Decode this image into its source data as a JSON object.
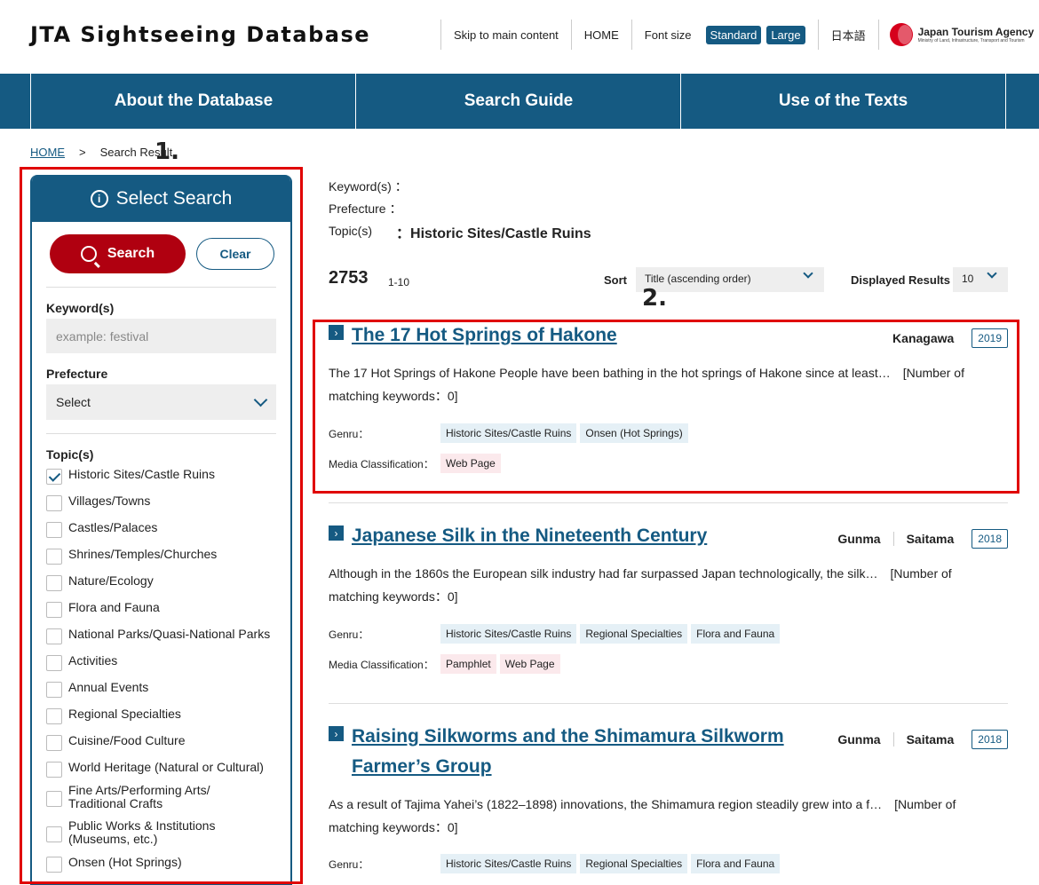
{
  "header": {
    "site_title": "JTA Sightseeing Database",
    "skip_link": "Skip to main content",
    "home": "HOME",
    "font_size_label": "Font size",
    "font_standard": "Standard",
    "font_large": "Large",
    "language": "日本語",
    "logo_name": "Japan Tourism Agency",
    "logo_sub": "Ministry of Land, Infrastructure, Transport and Tourism"
  },
  "nav": {
    "items": [
      "About the Database",
      "Search Guide",
      "Use of the Texts"
    ]
  },
  "breadcrumb": {
    "home": "HOME",
    "sep": ">",
    "current": "Search Result"
  },
  "annotations": {
    "one": "1.",
    "two": "2."
  },
  "sidebar": {
    "title": "Select Search",
    "search_label": "Search",
    "clear_label": "Clear",
    "keyword_label": "Keyword(s)",
    "keyword_placeholder": "example: festival",
    "prefecture_label": "Prefecture",
    "prefecture_value": "Select",
    "topics_label": "Topic(s)",
    "topics": [
      {
        "label": "Historic Sites/Castle Ruins",
        "checked": true
      },
      {
        "label": "Villages/Towns",
        "checked": false
      },
      {
        "label": "Castles/Palaces",
        "checked": false
      },
      {
        "label": "Shrines/Temples/Churches",
        "checked": false
      },
      {
        "label": "Nature/Ecology",
        "checked": false
      },
      {
        "label": "Flora and Fauna",
        "checked": false
      },
      {
        "label": "National Parks/Quasi-National Parks",
        "checked": false
      },
      {
        "label": "Activities",
        "checked": false
      },
      {
        "label": "Annual Events",
        "checked": false
      },
      {
        "label": "Regional Specialties",
        "checked": false
      },
      {
        "label": "Cuisine/Food Culture",
        "checked": false
      },
      {
        "label": "World Heritage (Natural or Cultural)",
        "checked": false
      },
      {
        "label": "Fine Arts/Performing Arts/ Traditional Crafts",
        "checked": false
      },
      {
        "label": "Public Works & Institutions (Museums, etc.)",
        "checked": false
      },
      {
        "label": "Onsen (Hot Springs)",
        "checked": false
      }
    ]
  },
  "criteria": {
    "keyword_label": "Keyword(s)",
    "keyword_value": "",
    "prefecture_label": "Prefecture",
    "prefecture_value": "",
    "topic_label": "Topic(s)",
    "topic_value": "Historic Sites/Castle Ruins",
    "colon": "："
  },
  "results_bar": {
    "count": "2753",
    "range": "1-10",
    "sort_label": "Sort",
    "sort_value": "Title (ascending order)",
    "displayed_label": "Displayed Results",
    "displayed_value": "10"
  },
  "results": [
    {
      "title": "The 17 Hot Springs of Hakone",
      "prefectures": [
        "Kanagawa"
      ],
      "year": "2019",
      "description": "The 17 Hot Springs of Hakone People have been bathing in the hot springs of Hakone since at least…　[Number of matching keywords：0]",
      "genre_label": "Genru：",
      "genres": [
        "Historic Sites/Castle Ruins",
        "Onsen (Hot Springs)"
      ],
      "media_label": "Media Classification：",
      "media": [
        "Web Page"
      ]
    },
    {
      "title": "Japanese Silk in the Nineteenth Century",
      "prefectures": [
        "Gunma",
        "Saitama"
      ],
      "year": "2018",
      "description": "Although in the 1860s the European silk industry had far surpassed Japan technologically, the silk…　[Number of matching keywords：0]",
      "genre_label": "Genru：",
      "genres": [
        "Historic Sites/Castle Ruins",
        "Regional Specialties",
        "Flora and Fauna"
      ],
      "media_label": "Media Classification：",
      "media": [
        "Pamphlet",
        "Web Page"
      ]
    },
    {
      "title": "Raising Silkworms and the Shimamura Silkworm Farmer’s Group",
      "prefectures": [
        "Gunma",
        "Saitama"
      ],
      "year": "2018",
      "description": "As a result of Tajima Yahei’s (1822–1898) innovations, the Shimamura region steadily grew into a f…　[Number of matching keywords：0]",
      "genre_label": "Genru：",
      "genres": [
        "Historic Sites/Castle Ruins",
        "Regional Specialties",
        "Flora and Fauna"
      ]
    }
  ]
}
